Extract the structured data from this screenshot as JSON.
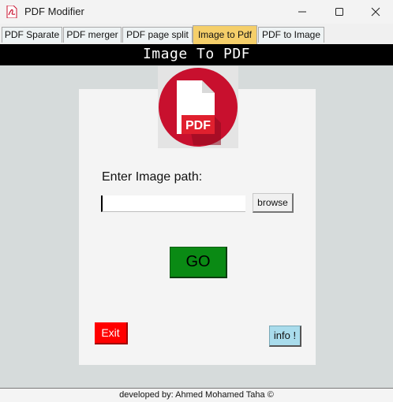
{
  "window": {
    "title": "PDF Modifier",
    "icon": "pdf-app-icon",
    "controls": [
      "minimize-icon",
      "maximize-icon",
      "close-icon"
    ]
  },
  "tabs": [
    {
      "label": "PDF Sparate",
      "active": false
    },
    {
      "label": "PDF merger",
      "active": false
    },
    {
      "label": "PDF page split",
      "active": false
    },
    {
      "label": "Image to Pdf",
      "active": true
    },
    {
      "label": "PDF to Image",
      "active": false
    }
  ],
  "header": {
    "title": "Image To PDF"
  },
  "logo": {
    "text": "PDF",
    "icon": "pdf-file-icon",
    "colors": {
      "circle": "#c8102e",
      "badge": "#e0202e"
    }
  },
  "form": {
    "path_label": "Enter Image path:",
    "path_value": "",
    "browse_label": "browse",
    "go_label": "GO"
  },
  "buttons": {
    "exit_label": "Exit",
    "info_label": "info !"
  },
  "footer": {
    "credit": "developed by: Ahmed Mohamed Taha ©"
  },
  "colors": {
    "active_tab": "#f5cf6a",
    "go": "#0a8a14",
    "exit": "#ff0000",
    "info": "#a9dcec",
    "header": "#000000"
  }
}
